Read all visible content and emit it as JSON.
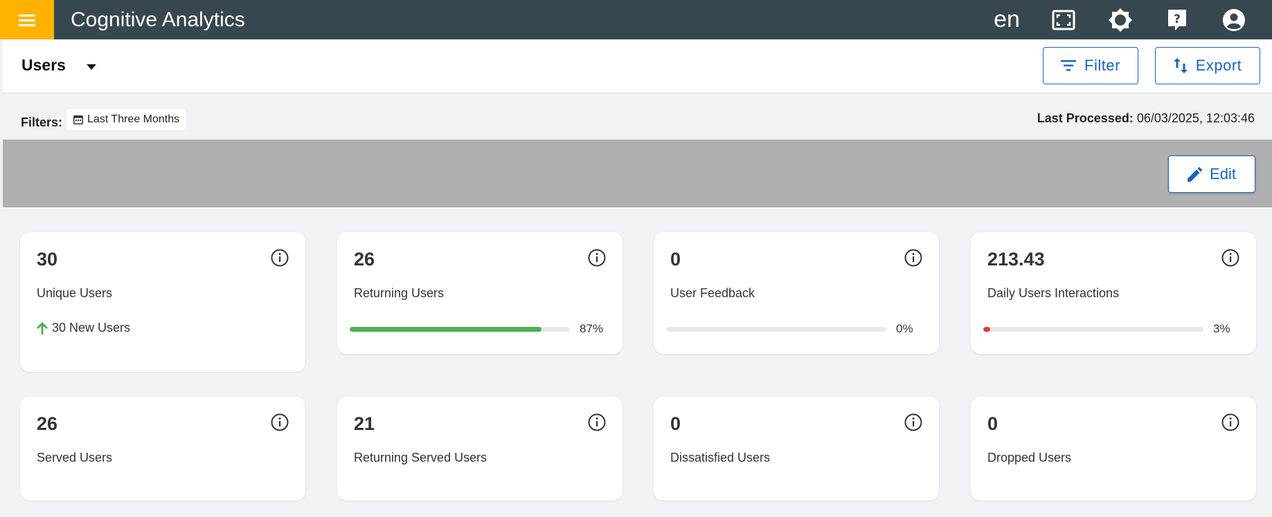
{
  "app": {
    "title": "Cognitive Analytics",
    "language": "en"
  },
  "colors": {
    "accent": "#1565c0",
    "topbar": "#37474f",
    "menu": "#ffb300",
    "success": "#4caf50",
    "danger": "#e53935"
  },
  "subheader": {
    "view_label": "Users",
    "filter_label": "Filter",
    "export_label": "Export"
  },
  "filters": {
    "label": "Filters:",
    "chip": "Last Three Months"
  },
  "last_processed": {
    "label": "Last Processed:",
    "value": "06/03/2025, 12:03:46"
  },
  "edit_label": "Edit",
  "cards": [
    {
      "value": "30",
      "title": "Unique Users",
      "trend": "30 New Users"
    },
    {
      "value": "26",
      "title": "Returning Users",
      "progress": 87,
      "progress_label": "87%",
      "bar_color": "#4caf50"
    },
    {
      "value": "0",
      "title": "User Feedback",
      "progress": 0,
      "progress_label": "0%",
      "bar_color": "#4caf50"
    },
    {
      "value": "213.43",
      "title": "Daily Users Interactions",
      "progress": 3,
      "progress_label": "3%",
      "bar_color": "#e53935"
    },
    {
      "value": "26",
      "title": "Served Users"
    },
    {
      "value": "21",
      "title": "Returning Served Users"
    },
    {
      "value": "0",
      "title": "Dissatisfied Users"
    },
    {
      "value": "0",
      "title": "Dropped Users"
    }
  ]
}
